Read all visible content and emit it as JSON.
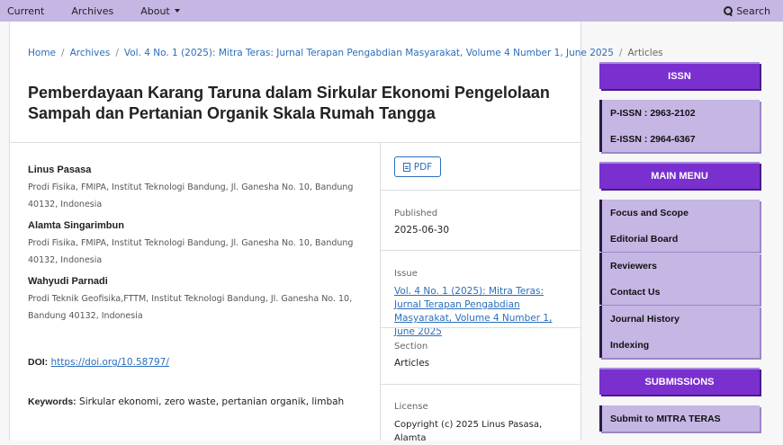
{
  "topnav": {
    "current": "Current",
    "archives": "Archives",
    "about": "About",
    "search": "Search"
  },
  "breadcrumb": {
    "home": "Home",
    "archives": "Archives",
    "issue": "Vol. 4 No. 1 (2025): Mitra Teras: Jurnal Terapan Pengabdian Masyarakat, Volume 4 Number 1, June 2025",
    "current": "Articles"
  },
  "article": {
    "title": "Pemberdayaan Karang Taruna dalam Sirkular Ekonomi Pengelolaan Sampah dan Pertanian Organik Skala Rumah Tangga",
    "authors": [
      {
        "name": "Linus Pasasa",
        "affiliation": "Prodi Fisika, FMIPA, Institut Teknologi Bandung, Jl. Ganesha No. 10, Bandung 40132, Indonesia"
      },
      {
        "name": "Alamta Singarimbun",
        "affiliation": "Prodi Fisika, FMIPA, Institut Teknologi Bandung, Jl. Ganesha No. 10, Bandung 40132, Indonesia"
      },
      {
        "name": "Wahyudi Parnadi",
        "affiliation": "Prodi Teknik Geofisika,FTTM, Institut Teknologi Bandung, Jl. Ganesha No. 10, Bandung 40132, Indonesia"
      }
    ],
    "doi_label": "DOI:",
    "doi_value": "https://doi.org/10.58797/",
    "keywords_label": "Keywords:",
    "keywords_value": "Sirkular ekonomi, zero waste, pertanian organik, limbah"
  },
  "details": {
    "pdf_label": "PDF",
    "published_label": "Published",
    "published_value": "2025-06-30",
    "issue_label": "Issue",
    "issue_value": "Vol. 4 No. 1 (2025): Mitra Teras: Jurnal Terapan Pengabdian Masyarakat, Volume 4 Number 1, June 2025",
    "section_label": "Section",
    "section_value": "Articles",
    "license_label": "License",
    "license_value": "Copyright (c) 2025 Linus Pasasa, Alamta"
  },
  "sidebar": {
    "issn_title": "ISSN",
    "pissn": "P-ISSN : 2963-2102",
    "eissn": "E-ISSN : 2964-6367",
    "main_menu_title": "MAIN MENU",
    "menu_items": [
      "Focus and Scope",
      "Editorial Board",
      "Reviewers",
      "Contact Us",
      "Journal History",
      "Indexing"
    ],
    "submissions_title": "SUBMISSIONS",
    "submit_label": "Submit to MITRA TERAS"
  },
  "colors": {
    "accent_purple": "#7a2fcf",
    "light_purple": "#c5b6e4",
    "link_blue": "#2a6ebb"
  }
}
